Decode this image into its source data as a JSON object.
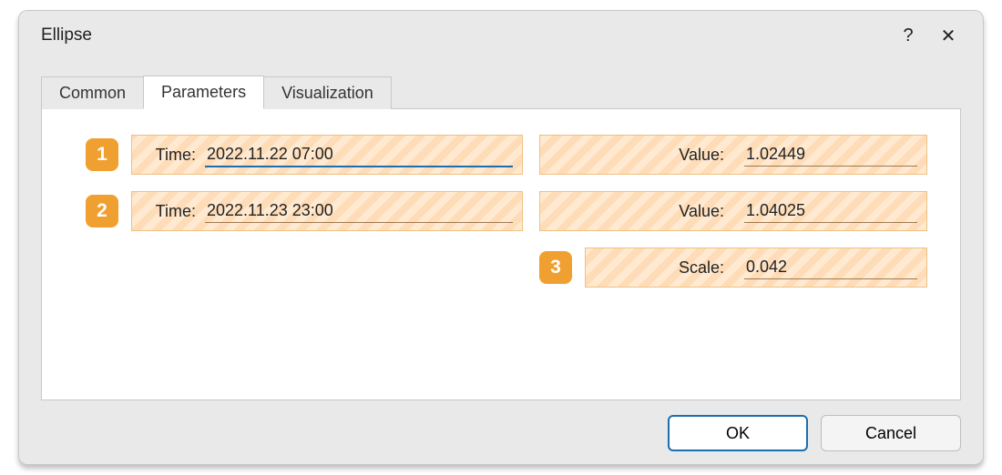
{
  "dialog": {
    "title": "Ellipse",
    "help_glyph": "?",
    "close_glyph": "✕"
  },
  "tabs": {
    "common": "Common",
    "parameters": "Parameters",
    "visualization": "Visualization",
    "active": "parameters"
  },
  "params": {
    "row1": {
      "badge": "1",
      "time_label": "Time:",
      "time_value": "2022.11.22 07:00",
      "value_label": "Value:",
      "value_value": "1.02449"
    },
    "row2": {
      "badge": "2",
      "time_label": "Time:",
      "time_value": "2022.11.23 23:00",
      "value_label": "Value:",
      "value_value": "1.04025"
    },
    "row3": {
      "badge": "3",
      "scale_label": "Scale:",
      "scale_value": "0.042"
    }
  },
  "footer": {
    "ok": "OK",
    "cancel": "Cancel"
  }
}
